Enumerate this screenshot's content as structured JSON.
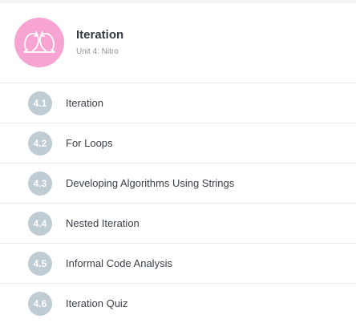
{
  "unit": {
    "title": "Iteration",
    "subtitle": "Unit 4: Nitro",
    "icon": "iteration-loop-icon",
    "icon_color": "#f7a4d3"
  },
  "lessons": [
    {
      "number": "4.1",
      "title": "Iteration"
    },
    {
      "number": "4.2",
      "title": "For Loops"
    },
    {
      "number": "4.3",
      "title": "Developing Algorithms Using Strings"
    },
    {
      "number": "4.4",
      "title": "Nested Iteration"
    },
    {
      "number": "4.5",
      "title": "Informal Code Analysis"
    },
    {
      "number": "4.6",
      "title": "Iteration Quiz"
    }
  ],
  "colors": {
    "badge": "#c0ccd3",
    "divider": "#e9ebee",
    "title_text": "#333b44",
    "subtitle_text": "#8a9399"
  }
}
